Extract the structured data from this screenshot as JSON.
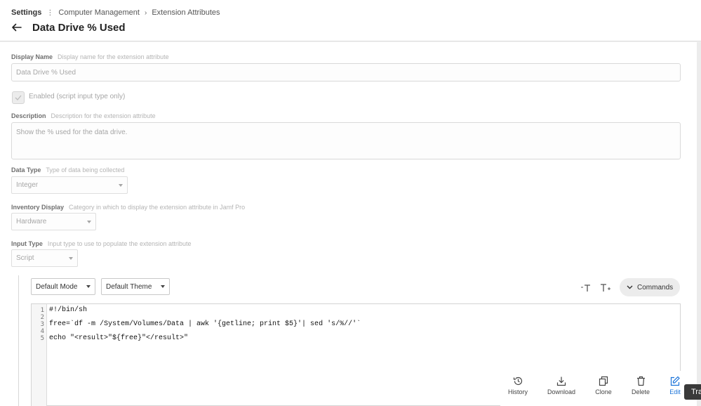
{
  "breadcrumb": {
    "root": "Settings",
    "items": [
      "Computer Management",
      "Extension Attributes"
    ]
  },
  "page": {
    "title": "Data Drive % Used"
  },
  "form": {
    "display_name": {
      "label": "Display Name",
      "hint": "Display name for the extension attribute",
      "value": "Data Drive % Used"
    },
    "enabled": {
      "label": "Enabled (script input type only)",
      "checked": true
    },
    "description": {
      "label": "Description",
      "hint": "Description for the extension attribute",
      "value": "Show the % used for the data drive."
    },
    "data_type": {
      "label": "Data Type",
      "hint": "Type of data being collected",
      "value": "Integer"
    },
    "inventory_display": {
      "label": "Inventory Display",
      "hint": "Category in which to display the extension attribute in Jamf Pro",
      "value": "Hardware"
    },
    "input_type": {
      "label": "Input Type",
      "hint": "Input type to use to populate the extension attribute",
      "value": "Script"
    }
  },
  "editor": {
    "mode": "Default Mode",
    "theme": "Default Theme",
    "commands_label": "Commands",
    "line_numbers": [
      "1",
      "2",
      "3",
      "4",
      "5"
    ],
    "lines": [
      "#!/bin/sh",
      "",
      "free=`df -m /System/Volumes/Data | awk '{getline; print $5}'| sed 's/%//'`",
      "",
      "echo \"<result>\"${free}\"</result>\""
    ]
  },
  "actions": {
    "history": "History",
    "download": "Download",
    "clone": "Clone",
    "delete": "Delete",
    "edit": "Edit"
  },
  "tooltip": "Tra",
  "colors": {
    "accent": "#1a73d9",
    "tooltip_bg": "#3a3a3a"
  }
}
